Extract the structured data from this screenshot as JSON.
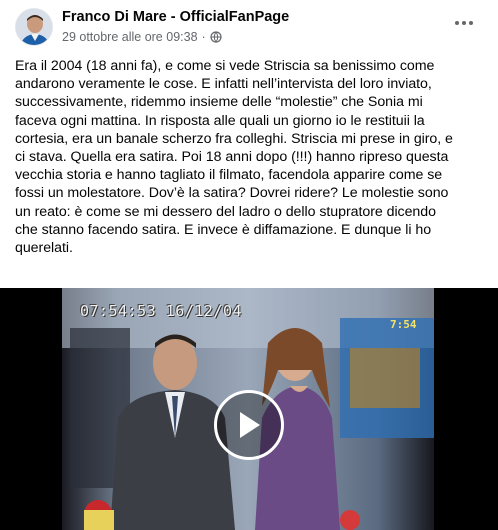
{
  "post": {
    "author": "Franco Di Mare - OfficialFanPage",
    "date": "29 ottobre alle ore 09:38",
    "separator": "·",
    "audience_icon": "globe-icon",
    "more_icon": "more-options-icon",
    "text": "Era il 2004 (18 anni fa), e come si vede Striscia sa benissimo come\nandarono veramente le cose. E infatti nell’intervista del loro inviato,\nsuccessivamente, ridemmo insieme delle “molestie” che Sonia mi\nfaceva ogni mattina. In risposta alle quali un giorno io le restituii la\ncortesia, era un banale scherzo fra colleghi. Striscia mi prese in giro, e\nci stava. Quella era satira. Poi 18 anni dopo (!!!) hanno ripreso questa\nvecchia storia e hanno tagliato il filmato, facendola apparire come se\nfossi un molestatore. Dov’è la satira? Dovrei ridere? Le molestie sono\nun reato: è come se mi dessero del ladro o dello stupratore dicendo\nche stanno facendo satira. E invece è diffamazione. E dunque li ho\nquerelati."
  },
  "video": {
    "timestamp": "07:54:53 16/12/04",
    "channel_clock": "7:54",
    "play_icon": "play-icon"
  },
  "colors": {
    "text": "#050505",
    "secondary": "#65676b",
    "video_bg": "#000000"
  }
}
